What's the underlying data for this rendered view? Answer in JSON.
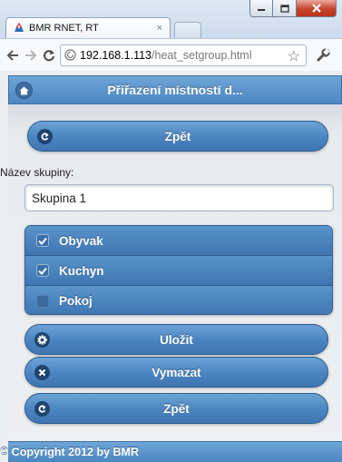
{
  "browser": {
    "tab_title": "BMR RNET, RT",
    "tab_close": "×",
    "url_host": "192.168.1.113",
    "url_path": "/heat_setgroup.html"
  },
  "header": {
    "title": "Přiřazení místností d..."
  },
  "content": {
    "back_button_top": "Zpět",
    "group_name_label": "Název skupiny:",
    "group_name_value": "Skupina 1",
    "rooms": [
      {
        "label": "Obyvak",
        "checked": true
      },
      {
        "label": "Kuchyn",
        "checked": true
      },
      {
        "label": "Pokoj",
        "checked": false
      }
    ],
    "save_button": "Uložit",
    "delete_button": "Vymazat",
    "back_button_bottom": "Zpět"
  },
  "footer": {
    "copyright": "© Copyright 2012 by BMR"
  },
  "colors": {
    "theme_blue": "#4a84c0",
    "icon_dark": "#1f4470",
    "page_bg": "#eceef1"
  }
}
